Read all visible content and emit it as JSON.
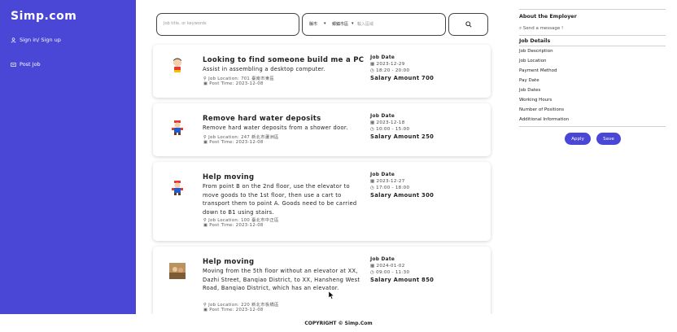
{
  "app": {
    "brand": "Simp.com",
    "nav": [
      {
        "label": "Sign in/ Sign up",
        "icon": "login-icon"
      },
      {
        "label": "Post Job",
        "icon": "post-job-icon"
      }
    ]
  },
  "search": {
    "keyword_placeholder": "Job title, or keywords",
    "city": "縣市",
    "district": "鄉鎮市區",
    "place_placeholder": "輸入區域",
    "button_icon": "search-icon"
  },
  "jobs": [
    {
      "title": "Looking to find someone build me a PC",
      "description": "Assist in assembling a desktop computer.",
      "location": "Job Location: 701 臺南市東區",
      "post_time": "Post Time: 2023-12-08",
      "date_label": "Job Date",
      "date": "2023-12-29",
      "time": "18:20 - 20:00",
      "salary": "Salary Amount 700",
      "thumb": "shin-chan-avatar"
    },
    {
      "title": "Remove hard water deposits",
      "description": "Remove hard water deposits from a shower door.",
      "location": "Job Location: 247 新北市蘆洲區",
      "post_time": "Post Time: 2023-12-08",
      "date_label": "Job Date",
      "date": "2023-12-18",
      "time": "10:00 - 15:00",
      "salary": "Salary Amount 250",
      "thumb": "mario-avatar"
    },
    {
      "title": "Help moving",
      "description": "From point B on the 2nd floor, use the elevator to move goods to the 1st floor, then use a cart to transport them to point A. Goods need to be carried down to B1 using stairs.",
      "location": "Job Location: 100 臺北市中正區",
      "post_time": "Post Time: 2023-12-08",
      "date_label": "Job Date",
      "date": "2023-12-27",
      "time": "17:00 - 18:00",
      "salary": "Salary Amount 300",
      "thumb": "mario-avatar"
    },
    {
      "title": "Help moving",
      "description": "Moving from the 5th floor without an elevator at XX, Dazhi Street, Banqiao District, to XX, Hansheng West Road, Banqiao District, which has an elevator.",
      "location": "Job Location: 220 新北市板橋區",
      "post_time": "Post Time: 2023-12-08",
      "date_label": "Job Date",
      "date": "2024-01-02",
      "time": "09:00 - 11:30",
      "salary": "Salary Amount 850",
      "thumb": "photo-avatar"
    }
  ],
  "detail": {
    "about_title": "About the Employer",
    "send_message": "Send a message !",
    "details_title": "Job Details",
    "fields": [
      "Job Description",
      "Job Location",
      "Payment Method",
      "Pay Date",
      "Job Dates",
      "Working Hours",
      "Number of Positions",
      "Additional Information"
    ],
    "apply_label": "Apply",
    "save_label": "Save"
  },
  "footer": {
    "copyright": "COPYRIGHT © Simp.Com"
  },
  "colors": {
    "brand": "#4a46d6",
    "card_shadow": "#cccccc"
  }
}
